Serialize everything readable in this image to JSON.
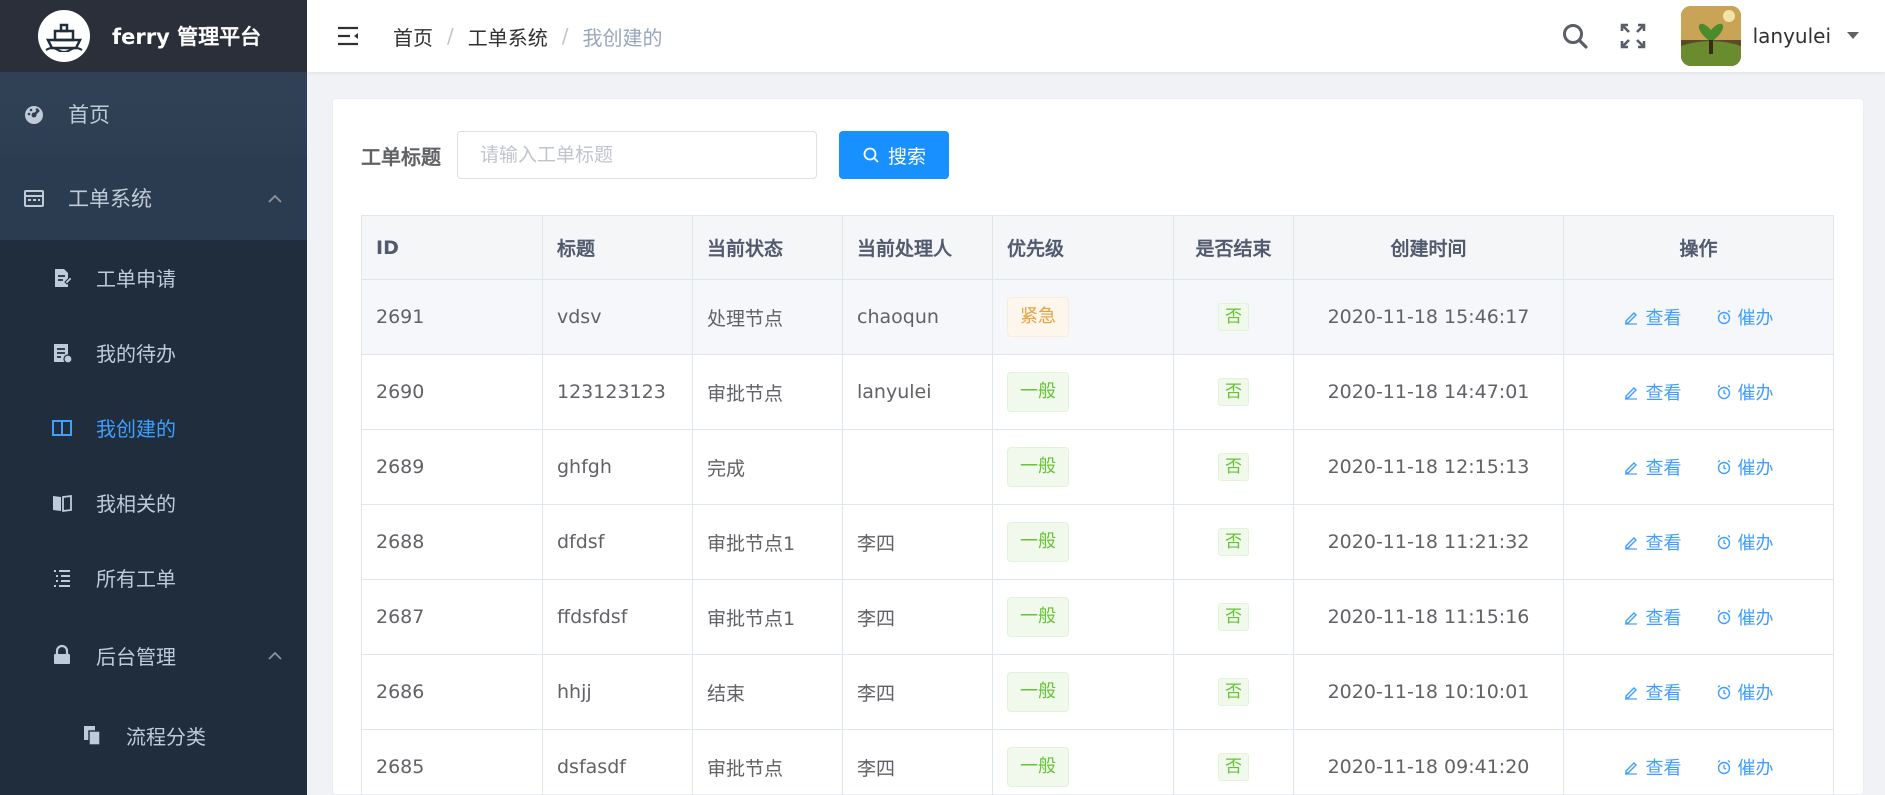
{
  "app": {
    "title": "ferry 管理平台"
  },
  "sidebar": {
    "home": "首页",
    "workorder_system": "工单系统",
    "items": [
      {
        "label": "工单申请",
        "icon": "document-edit-icon"
      },
      {
        "label": "我的待办",
        "icon": "todo-list-icon"
      },
      {
        "label": "我创建的",
        "icon": "columns-icon"
      },
      {
        "label": "我相关的",
        "icon": "book-icon"
      },
      {
        "label": "所有工单",
        "icon": "list-icon"
      }
    ],
    "admin": "后台管理",
    "admin_items": [
      {
        "label": "流程分类",
        "icon": "copy-icon"
      }
    ],
    "active_color": "#409eff"
  },
  "header": {
    "breadcrumb": [
      "首页",
      "工单系统",
      "我创建的"
    ],
    "username": "lanyulei"
  },
  "search": {
    "label": "工单标题",
    "placeholder": "请输入工单标题",
    "button": "搜索"
  },
  "table": {
    "columns": [
      "ID",
      "标题",
      "当前状态",
      "当前处理人",
      "优先级",
      "是否结束",
      "创建时间",
      "操作"
    ],
    "rows": [
      {
        "id": "2691",
        "title": "vdsv",
        "status": "处理节点",
        "handler": "chaoqun",
        "priority": "紧急",
        "priority_type": "warning",
        "ended": "否",
        "created": "2020-11-18 15:46:17"
      },
      {
        "id": "2690",
        "title": "123123123",
        "status": "审批节点",
        "handler": "lanyulei",
        "priority": "一般",
        "priority_type": "success",
        "ended": "否",
        "created": "2020-11-18 14:47:01"
      },
      {
        "id": "2689",
        "title": "ghfgh",
        "status": "完成",
        "handler": "",
        "priority": "一般",
        "priority_type": "success",
        "ended": "否",
        "created": "2020-11-18 12:15:13"
      },
      {
        "id": "2688",
        "title": "dfdsf",
        "status": "审批节点1",
        "handler": "李四",
        "priority": "一般",
        "priority_type": "success",
        "ended": "否",
        "created": "2020-11-18 11:21:32"
      },
      {
        "id": "2687",
        "title": "ffdsfdsf",
        "status": "审批节点1",
        "handler": "李四",
        "priority": "一般",
        "priority_type": "success",
        "ended": "否",
        "created": "2020-11-18 11:15:16"
      },
      {
        "id": "2686",
        "title": "hhjj",
        "status": "结束",
        "handler": "李四",
        "priority": "一般",
        "priority_type": "success",
        "ended": "否",
        "created": "2020-11-18 10:10:01"
      },
      {
        "id": "2685",
        "title": "dsfasdf",
        "status": "审批节点",
        "handler": "李四",
        "priority": "一般",
        "priority_type": "success",
        "ended": "否",
        "created": "2020-11-18 09:41:20"
      }
    ],
    "actions": {
      "view": "查看",
      "urge": "催办"
    }
  },
  "colors": {
    "primary": "#1890ff",
    "sidebar_bg": "#1f2d3d",
    "warning": "#e6a23c",
    "success": "#67c23a"
  }
}
